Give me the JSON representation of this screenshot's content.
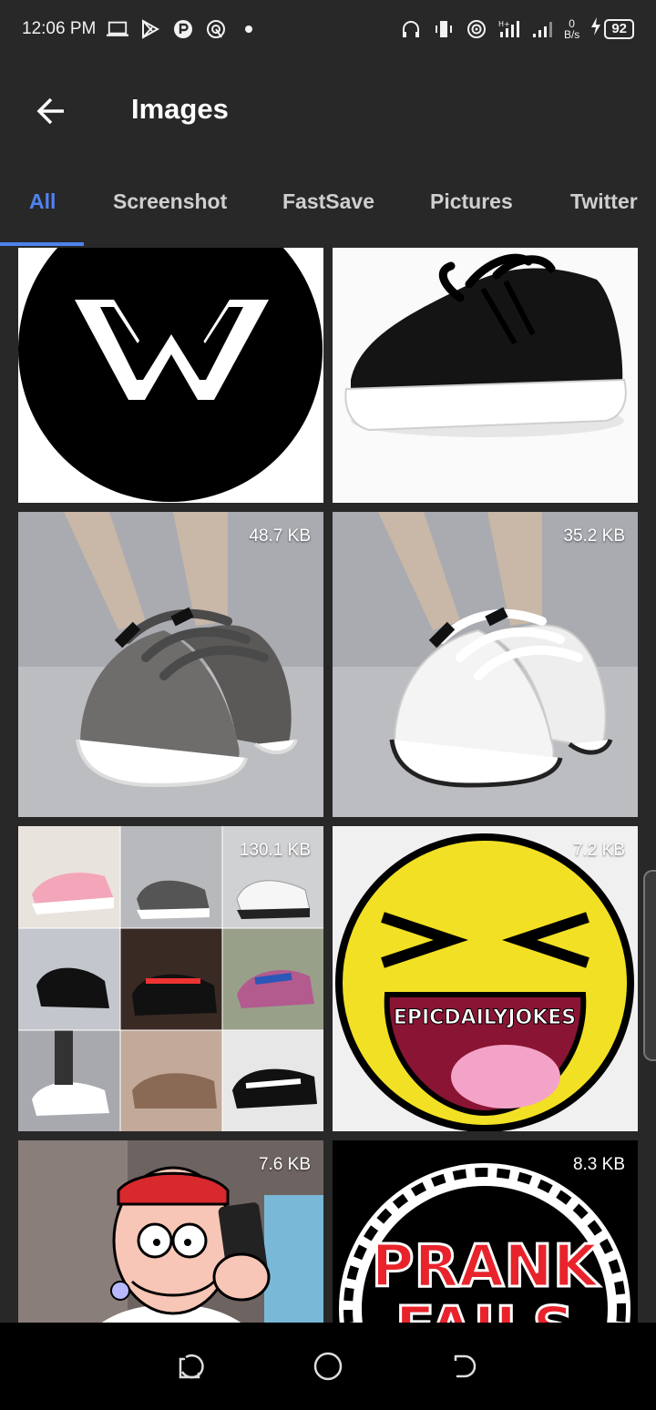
{
  "status_bar": {
    "time": "12:06 PM",
    "net_speed_value": "0",
    "net_speed_unit": "B/s",
    "battery": "92",
    "left_icons": [
      "laptop-icon",
      "play-store-icon",
      "p-app-icon",
      "radar-icon",
      "dot-icon"
    ],
    "right_icons": [
      "headphones-icon",
      "vibrate-icon",
      "hotspot-icon",
      "signal-icon",
      "signal2-icon",
      "charging-icon"
    ]
  },
  "toolbar": {
    "title": "Images"
  },
  "tabs": [
    {
      "label": "All",
      "active": true
    },
    {
      "label": "Screenshot"
    },
    {
      "label": "FastSave"
    },
    {
      "label": "Pictures"
    },
    {
      "label": "Twitter"
    }
  ],
  "grid": {
    "items": [
      {
        "kind": "w-logo"
      },
      {
        "kind": "black-sneaker"
      },
      {
        "kind": "grey-sneakers",
        "size": "48.7 KB"
      },
      {
        "kind": "white-sneakers",
        "size": "35.2 KB"
      },
      {
        "kind": "sneaker-collage",
        "size": "130.1 KB"
      },
      {
        "kind": "laughing-emoji",
        "size": "7.2 KB",
        "caption": "EPICDAILYJOKES"
      },
      {
        "kind": "cartoon-man",
        "size": "7.6 KB"
      },
      {
        "kind": "prank-fails-logo",
        "size": "8.3 KB",
        "caption_line1": "PRANK",
        "caption_line2": "FAILS"
      }
    ]
  },
  "colors": {
    "background": "#282828",
    "accent": "#4f82f0",
    "nav_bar": "#000000"
  }
}
